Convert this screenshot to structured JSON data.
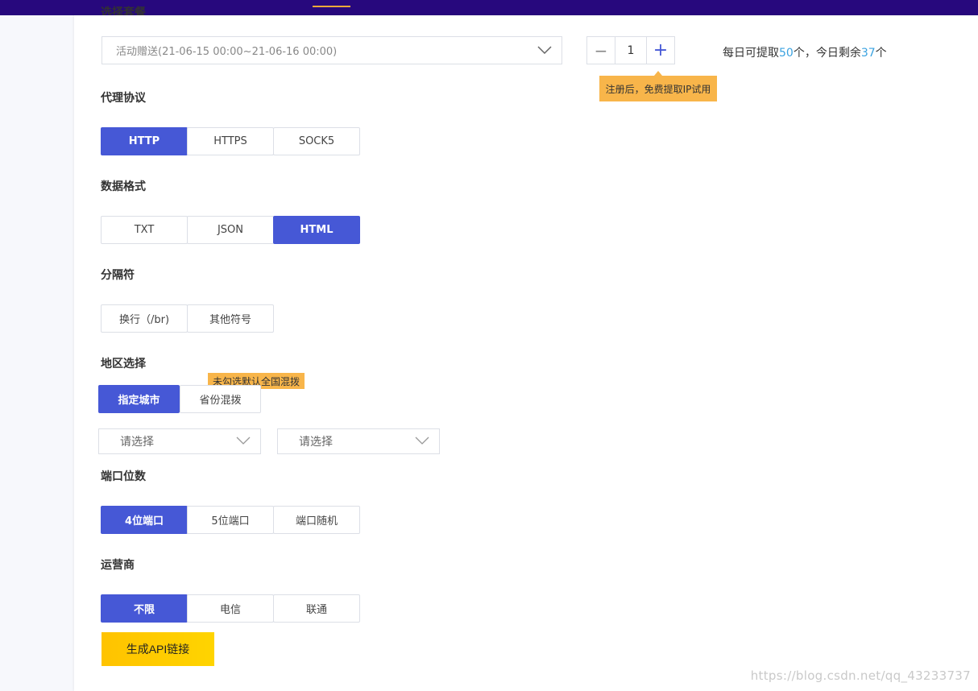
{
  "package": {
    "section_label": "选择套餐",
    "selected": "活动赠送(21-06-15 00:00~21-06-16 00:00)",
    "quantity": "1",
    "minus_symbol": "−",
    "plus_symbol": "+",
    "tooltip": "注册后，免费提取IP试用",
    "quota_prefix": "每日可提取",
    "quota_daily": "50",
    "quota_mid": "个，今日剩余",
    "quota_remaining": "37",
    "quota_suffix": "个"
  },
  "protocol": {
    "label": "代理协议",
    "options": [
      "HTTP",
      "HTTPS",
      "SOCK5"
    ],
    "selected": "HTTP"
  },
  "format": {
    "label": "数据格式",
    "options": [
      "TXT",
      "JSON",
      "HTML"
    ],
    "selected": "HTML"
  },
  "separator": {
    "label": "分隔符",
    "options": [
      "换行（/br)",
      "其他符号"
    ]
  },
  "region": {
    "label": "地区选择",
    "options": [
      "指定城市",
      "省份混拨"
    ],
    "selected": "指定城市",
    "tooltip": "未勾选默认全国混拨",
    "select1_placeholder": "请选择",
    "select2_placeholder": "请选择"
  },
  "port": {
    "label": "端口位数",
    "options": [
      "4位端口",
      "5位端口",
      "端口随机"
    ],
    "selected": "4位端口"
  },
  "isp": {
    "label": "运营商",
    "options": [
      "不限",
      "电信",
      "联通"
    ],
    "selected": "不限"
  },
  "generate_button": "生成API链接",
  "watermark": "https://blog.csdn.net/qq_43233737",
  "colors": {
    "topbar": "#27087d",
    "accent": "#4658d6",
    "tooltip": "#f8b54a",
    "quota_number": "#3aa2e0",
    "generate": "#ffc300"
  }
}
